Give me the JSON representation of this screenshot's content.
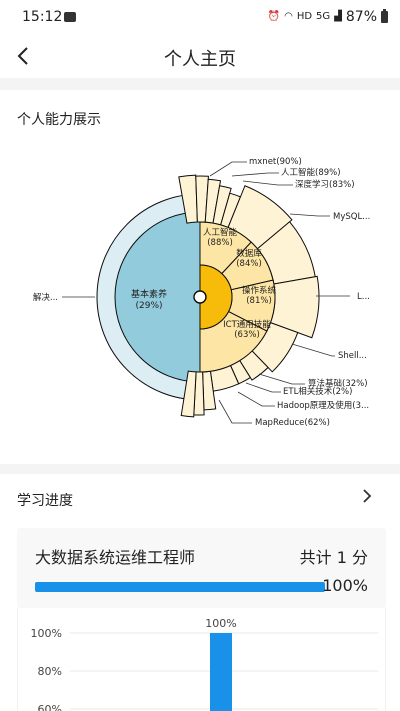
{
  "status_bar": {
    "time": "15:12",
    "network": "HD",
    "signal": "5G",
    "battery": "87%"
  },
  "header": {
    "title": "个人主页"
  },
  "ability": {
    "section_title": "个人能力展示",
    "chart_data": {
      "type": "sunburst",
      "left_half": [
        {
          "label": "基本素养",
          "value_label": "(29%)"
        }
      ],
      "left_outer_labels": [
        "解决..."
      ],
      "right_inner": [
        {
          "label": "人工智能",
          "value_label": "(88%)"
        },
        {
          "label": "数据库",
          "value_label": "(84%)"
        },
        {
          "label": "操作系统",
          "value_label": "(81%)"
        },
        {
          "label": "ICT通用技能",
          "value_label": "(63%)"
        }
      ],
      "right_outer_labels": [
        "mxnet(90%)",
        "人工智能(89%)",
        "深度学习(83%)",
        "MySQL...",
        "L...",
        "Shell...",
        "算法基础(32%)",
        "ETL相关技术(2%)",
        "Hadoop原理及使用(3...",
        "MapReduce(62%)"
      ],
      "colors": {
        "left_inner": "#92cbdc",
        "left_outer": "#dcedf4",
        "core": "#f7bb0a",
        "right_mid": "#fde6a5",
        "right_outer": "#fef3d4",
        "stroke": "#0c0c0c"
      }
    }
  },
  "progress": {
    "section_title": "学习进度",
    "job": {
      "title": "大数据系统运维工程师",
      "total": "共计 1 分",
      "percent": "100%",
      "fill": 1.0
    },
    "chart_data": {
      "type": "bar",
      "y_ticks": [
        "100%",
        "80%",
        "60%"
      ],
      "values": [
        100
      ],
      "data_labels": [
        "100%"
      ],
      "color": "#1a91e8"
    }
  }
}
